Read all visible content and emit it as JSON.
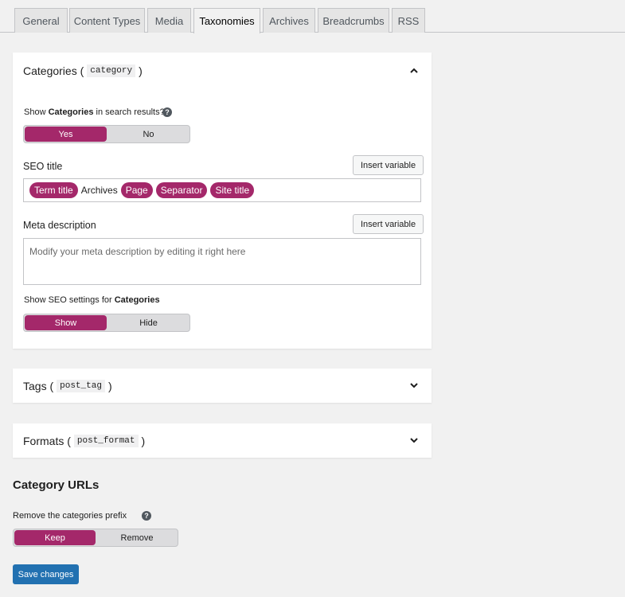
{
  "tabs": [
    "General",
    "Content Types",
    "Media",
    "Taxonomies",
    "Archives",
    "Breadcrumbs",
    "RSS"
  ],
  "categories": {
    "title": "Categories (",
    "code": "category",
    "title_end": ")",
    "search_label_pre": "Show",
    "search_label_bold": "Categories",
    "search_label_post": "in search results?",
    "search_yes": "Yes",
    "search_no": "No",
    "seo_title_label": "SEO title",
    "insert_variable": "Insert variable",
    "seo_tokens": {
      "t1": "Term title",
      "t2": "Archives",
      "t3": "Page",
      "t4": "Separator",
      "t5": "Site title"
    },
    "meta_label": "Meta description",
    "meta_placeholder": "Modify your meta description by editing it right here",
    "show_settings_pre": "Show SEO settings for",
    "show_settings_bold": "Categories",
    "show": "Show",
    "hide": "Hide"
  },
  "tags": {
    "title": "Tags (",
    "code": "post_tag",
    "title_end": ")"
  },
  "formats": {
    "title": "Formats (",
    "code": "post_format",
    "title_end": ")"
  },
  "category_urls": {
    "heading": "Category URLs",
    "prefix_label": "Remove the categories prefix",
    "keep": "Keep",
    "remove": "Remove"
  },
  "help_glyph": "?",
  "save_label": "Save changes",
  "colors": {
    "accent": "#a4286a",
    "primary": "#2271b1"
  }
}
